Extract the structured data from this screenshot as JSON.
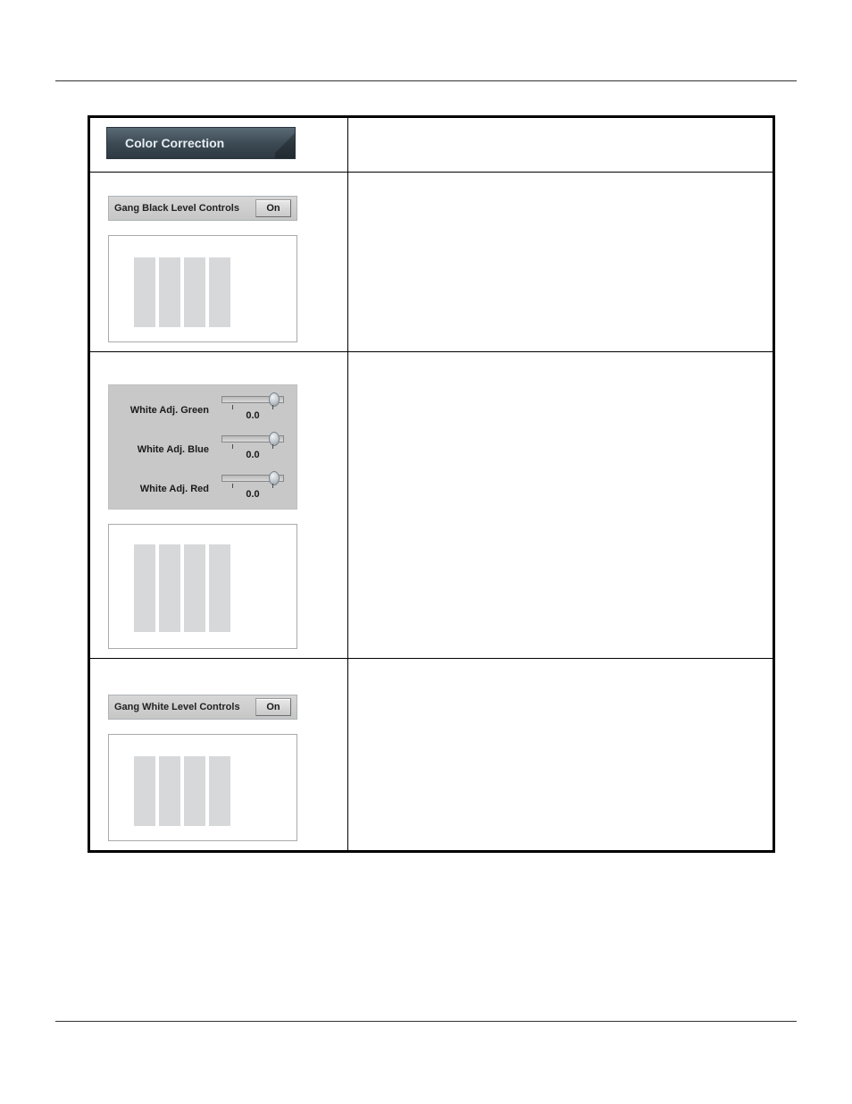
{
  "header": {
    "badge_title": "Color Correction"
  },
  "gang_black": {
    "label": "Gang Black Level Controls",
    "button": "On"
  },
  "white_adj": {
    "rows": [
      {
        "label": "White Adj. Green",
        "value": "0.0"
      },
      {
        "label": "White Adj. Blue",
        "value": "0.0"
      },
      {
        "label": "White Adj. Red",
        "value": "0.0"
      }
    ]
  },
  "gang_white": {
    "label": "Gang White Level Controls",
    "button": "On"
  }
}
